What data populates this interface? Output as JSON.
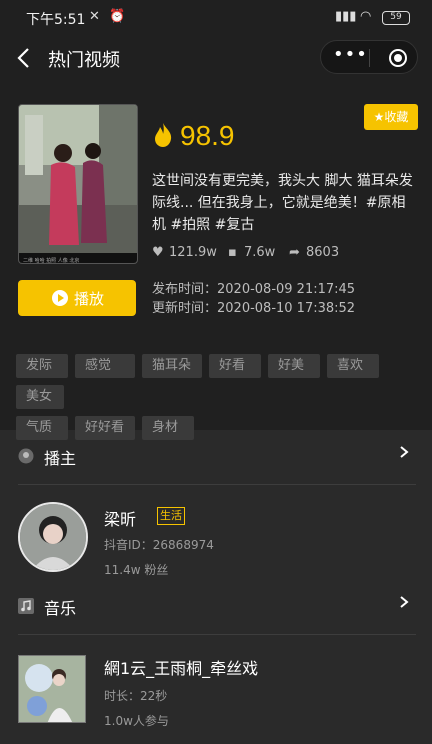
{
  "status_bar": {
    "time": "下午5:51",
    "battery": "59"
  },
  "nav": {
    "title": "热门视频",
    "more": "•••"
  },
  "video": {
    "heat": "98.9",
    "favorite_label": "收藏",
    "description": "这世间没有更完美，我头大 脚大 猫耳朵发际线... 但在我身上，它就是绝美！#原相机 #拍照 #复古",
    "likes": "121.9w",
    "comments": "7.6w",
    "shares": "8603",
    "play_label": "播放",
    "published": "发布时间：2020-08-09 21:17:45",
    "updated": "更新时间：2020-08-10 17:38:52",
    "tags": [
      "发际",
      "感觉",
      "猫耳朵",
      "好看",
      "好美",
      "喜欢",
      "美女",
      "气质",
      "好好看",
      "身材"
    ]
  },
  "host_section": {
    "title": "播主",
    "name": "梁昕",
    "badge": "生活",
    "douyin_id": "抖音ID：26868974",
    "fans": "11.4w 粉丝"
  },
  "music_section": {
    "title": "音乐",
    "song": "網1云_王雨桐_牵丝戏",
    "duration": "时长：22秒",
    "participants": "1.0w人参与"
  },
  "colors": {
    "accent": "#f6c300",
    "background": "#2a2a2a",
    "card": "#202020"
  }
}
